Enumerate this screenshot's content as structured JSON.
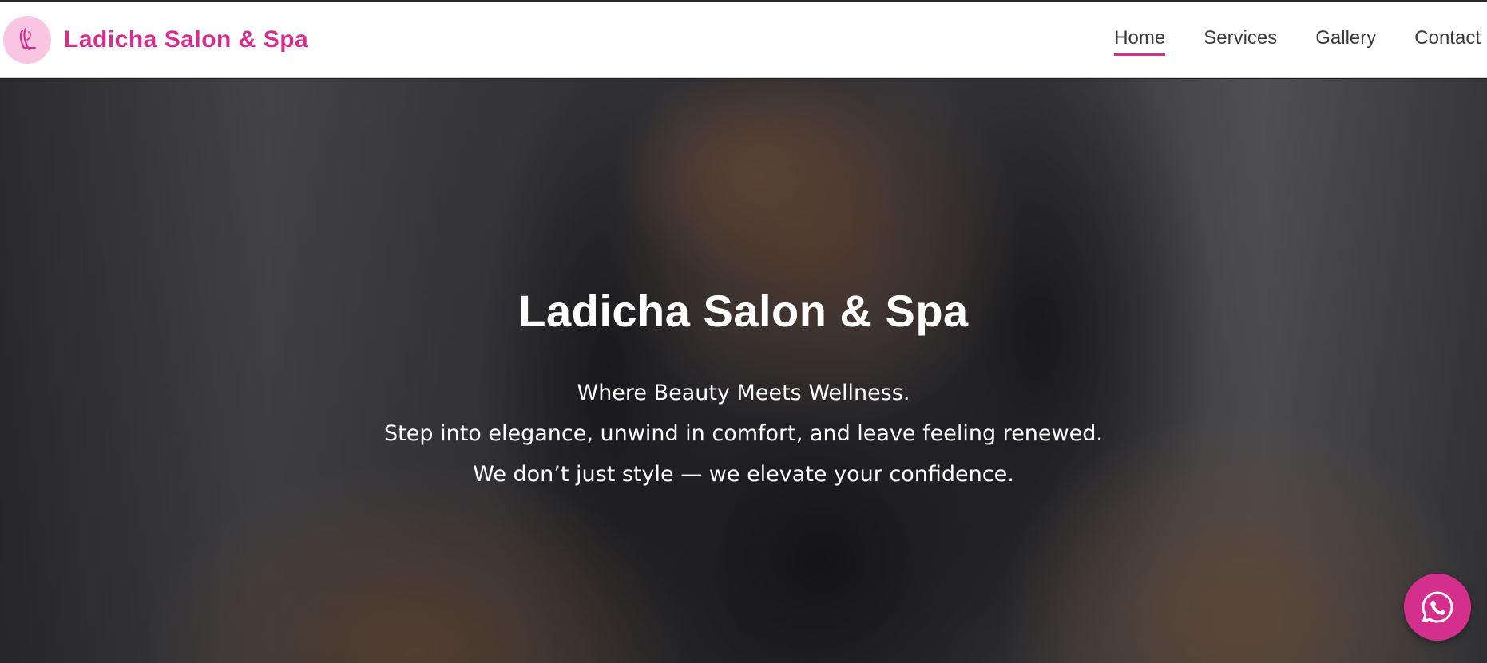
{
  "header": {
    "brand_name": "Ladicha Salon & Spa",
    "logo_icon": "ladicha-logo-icon",
    "nav": [
      {
        "label": "Home",
        "active": true
      },
      {
        "label": "Services",
        "active": false
      },
      {
        "label": "Gallery",
        "active": false
      },
      {
        "label": "Contact",
        "active": false
      }
    ]
  },
  "hero": {
    "title": "Ladicha Salon & Spa",
    "line1": "Where Beauty Meets Wellness.",
    "line2": "Step into elegance, unwind in comfort, and leave feeling renewed.",
    "line3": "We don’t just style — we elevate your confidence."
  },
  "floating": {
    "icon": "whatsapp-icon"
  },
  "colors": {
    "brand": "#d42f8d",
    "logo_bg": "#f8c6e3",
    "nav_text": "#3a3a3a",
    "hero_text": "#ffffff"
  }
}
